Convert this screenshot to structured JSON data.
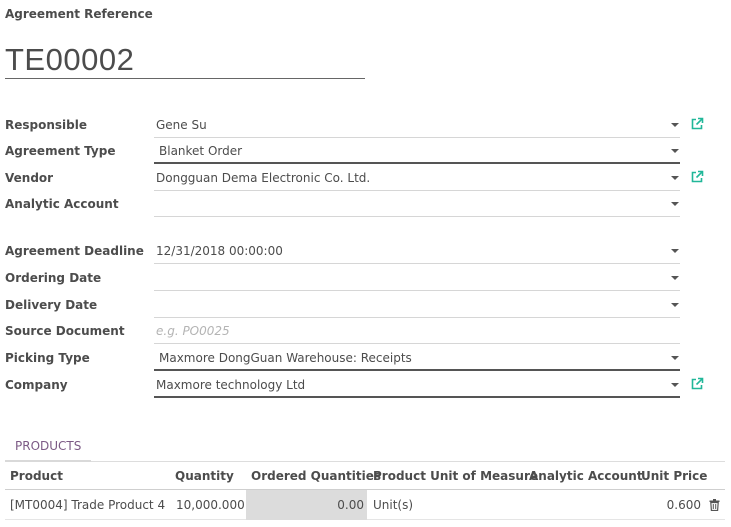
{
  "reference": {
    "label": "Agreement Reference",
    "value": "TE00002"
  },
  "fields": {
    "responsible": {
      "label": "Responsible",
      "value": "Gene Su"
    },
    "agreement_type": {
      "label": "Agreement Type",
      "value": "Blanket Order"
    },
    "vendor": {
      "label": "Vendor",
      "value": "Dongguan Dema Electronic Co. Ltd."
    },
    "analytic_account": {
      "label": "Analytic Account",
      "value": ""
    },
    "agreement_deadline": {
      "label": "Agreement Deadline",
      "value": "12/31/2018 00:00:00"
    },
    "ordering_date": {
      "label": "Ordering Date",
      "value": ""
    },
    "delivery_date": {
      "label": "Delivery Date",
      "value": ""
    },
    "source_document": {
      "label": "Source Document",
      "value": "",
      "placeholder": "e.g. PO0025"
    },
    "picking_type": {
      "label": "Picking Type",
      "value": "Maxmore DongGuan Warehouse: Receipts"
    },
    "company": {
      "label": "Company",
      "value": "Maxmore technology Ltd"
    }
  },
  "tabs": {
    "products": "PRODUCTS"
  },
  "table": {
    "headers": {
      "product": "Product",
      "quantity": "Quantity",
      "ordered_quantities": "Ordered Quantities",
      "uom": "Product Unit of Measure",
      "analytic_account": "Analytic Account",
      "unit_price": "Unit Price"
    },
    "rows": [
      {
        "product": "[MT0004] Trade Product 4",
        "quantity": "10,000.000",
        "ordered_quantities": "0.00",
        "uom": "Unit(s)",
        "analytic_account": "",
        "unit_price": "0.600"
      }
    ]
  },
  "colors": {
    "accent": "#7c5a85",
    "external_link": "#21b799"
  },
  "icons": {
    "external": "external-link-icon",
    "delete": "trash-icon"
  }
}
